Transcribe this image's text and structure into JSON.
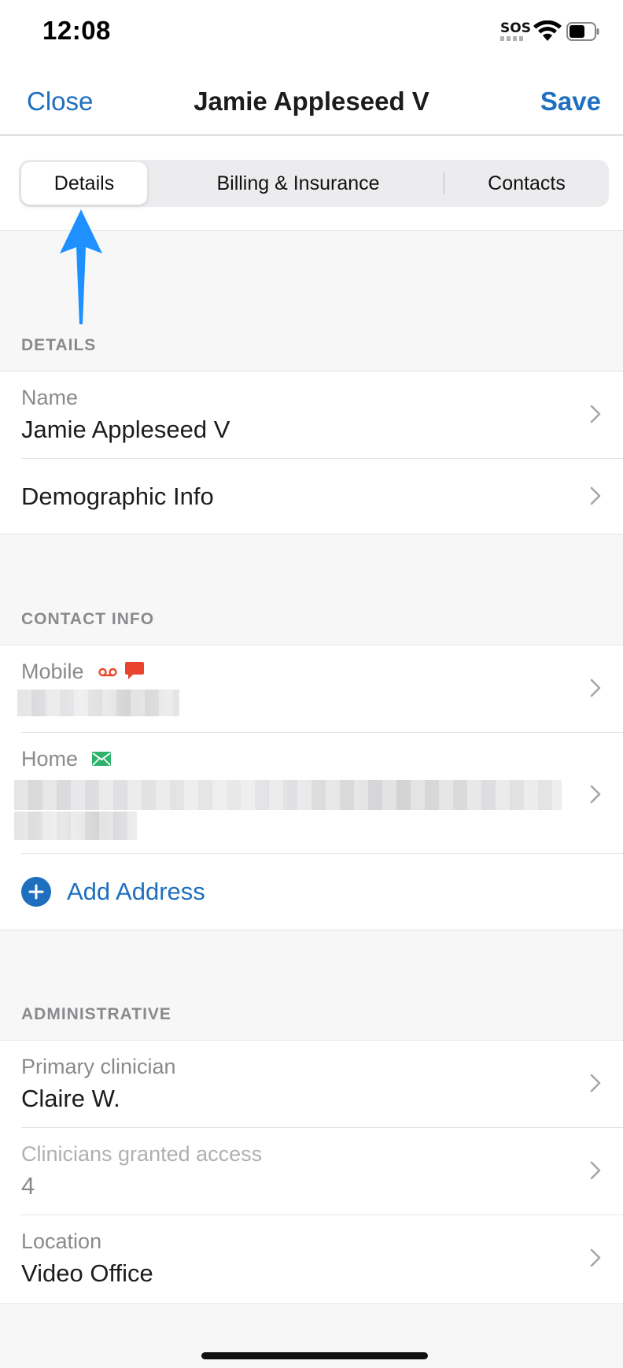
{
  "status_bar": {
    "time": "12:08",
    "sos": "SOS",
    "icons": [
      "wifi-icon",
      "battery-icon"
    ]
  },
  "nav": {
    "close_label": "Close",
    "title": "Jamie Appleseed V",
    "save_label": "Save"
  },
  "tabs": [
    {
      "label": "Details",
      "selected": true
    },
    {
      "label": "Billing & Insurance",
      "selected": false
    },
    {
      "label": "Contacts",
      "selected": false
    }
  ],
  "sections": {
    "details": {
      "header": "DETAILS",
      "name_label": "Name",
      "name_value": "Jamie Appleseed V",
      "demographic_label": "Demographic Info"
    },
    "contact_info": {
      "header": "CONTACT INFO",
      "mobile_label": "Mobile",
      "home_label": "Home",
      "add_address_label": "Add Address"
    },
    "administrative": {
      "header": "ADMINISTRATIVE",
      "primary_clinician_label": "Primary clinician",
      "primary_clinician_value": "Claire W.",
      "clinicians_access_label": "Clinicians granted access",
      "clinicians_access_value": "4",
      "location_label": "Location",
      "location_value": "Video Office"
    }
  },
  "colors": {
    "accent": "#1f6fbf",
    "annotation_arrow": "#1e90ff",
    "voicemail_icon": "#e8442e",
    "text_icon": "#e8442e",
    "email_icon": "#2fb36b"
  }
}
